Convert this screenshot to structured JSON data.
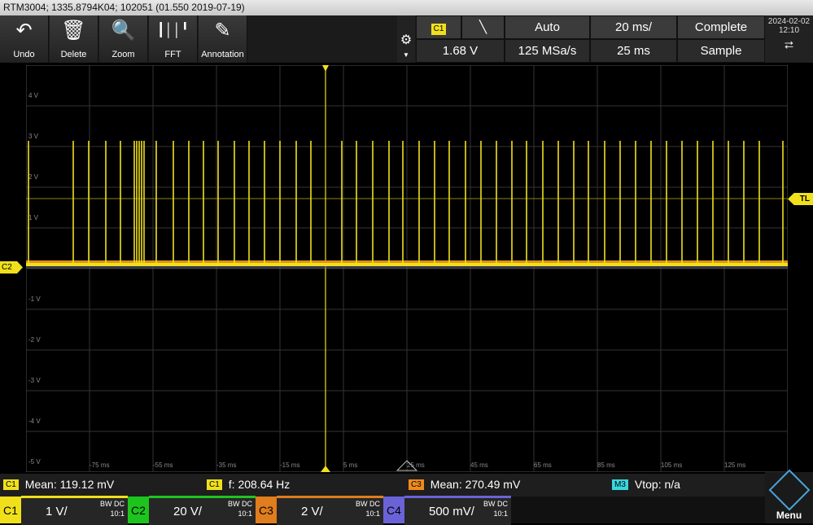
{
  "title": "RTM3004; 1335.8794K04; 102051 (01.550 2019-07-19)",
  "toolbar": {
    "undo": "Undo",
    "delete": "Delete",
    "zoom": "Zoom",
    "fft": "FFT",
    "annotation": "Annotation"
  },
  "trigger": {
    "source": "C1",
    "mode": "Auto",
    "level": "1.68 V",
    "time_scale": "20 ms/",
    "sample_rate": "125 MSa/s",
    "acq_time": "25 ms",
    "acq_status": "Complete",
    "acq_mode": "Sample"
  },
  "date": "2024-02-02",
  "time": "12:10",
  "markers": {
    "channel": "C2",
    "trigger_level": "TL"
  },
  "axis": {
    "y_labels": [
      "4 V",
      "3 V",
      "2 V",
      "1 V",
      "-1 V",
      "-2 V",
      "-3 V",
      "-4 V",
      "-5 V"
    ],
    "x_labels": [
      "-75 ms",
      "-55 ms",
      "-35 ms",
      "-15 ms",
      "5 ms",
      "25 ms",
      "45 ms",
      "65 ms",
      "85 ms",
      "105 ms",
      "125 ms"
    ]
  },
  "measurements": [
    {
      "tag": "C1",
      "text": "Mean: 119.12 mV",
      "color": "#f0e01c"
    },
    {
      "tag": "C1",
      "text": "f: 208.64 Hz",
      "color": "#f0e01c"
    },
    {
      "tag": "C3",
      "text": "Mean: 270.49 mV",
      "color": "#f08a1c"
    },
    {
      "tag": "M3",
      "text": "Vtop: n/a",
      "color": "#38d6e0"
    }
  ],
  "channels": [
    {
      "id": "C1",
      "scale": "1 V/",
      "bw": "BW DC",
      "probe": "10:1",
      "color": "#f0e01c"
    },
    {
      "id": "C2",
      "scale": "20 V/",
      "bw": "BW DC",
      "probe": "10:1",
      "color": "#1ec41e"
    },
    {
      "id": "C3",
      "scale": "2 V/",
      "bw": "BW DC",
      "probe": "10:1",
      "color": "#e07d1c"
    },
    {
      "id": "C4",
      "scale": "500 mV/",
      "bw": "BW DC",
      "probe": "10:1",
      "color": "#6a63d8"
    }
  ],
  "menu_label": "Menu"
}
